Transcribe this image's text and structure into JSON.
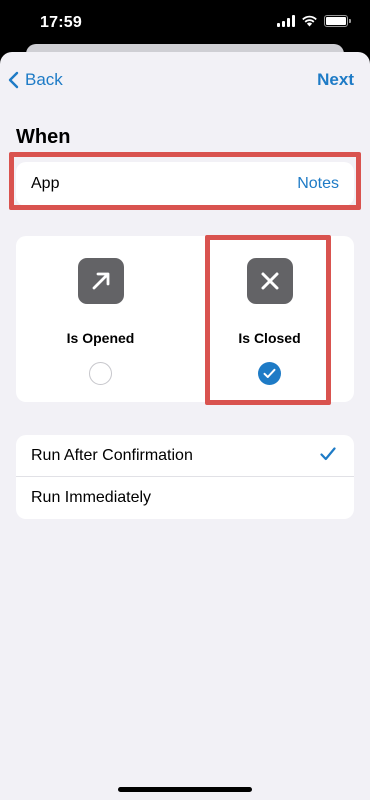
{
  "status_bar": {
    "time": "17:59"
  },
  "nav": {
    "back_label": "Back",
    "next_label": "Next"
  },
  "section_title": "When",
  "app_row": {
    "label": "App",
    "value": "Notes"
  },
  "choices": [
    {
      "label": "Is Opened",
      "icon": "arrow-up-right-icon",
      "selected": false
    },
    {
      "label": "Is Closed",
      "icon": "x-mark-icon",
      "selected": true
    }
  ],
  "run_options": [
    {
      "label": "Run After Confirmation",
      "checked": true
    },
    {
      "label": "Run Immediately",
      "checked": false
    }
  ],
  "colors": {
    "accent": "#1e7bc6",
    "highlight": "#d9534f",
    "background": "#f2f1f6",
    "icon_tile": "#636366"
  }
}
